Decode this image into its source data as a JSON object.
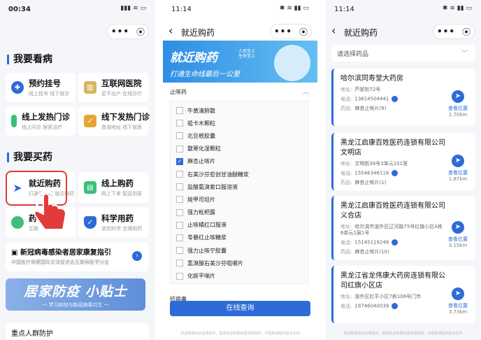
{
  "panel1": {
    "time": "00:34",
    "status_icons": "▮▮▮ ≋ ▭",
    "section_1": "我要看病",
    "cards_1": [
      {
        "title": "预约挂号",
        "sub": "线上挂号 线下就诊",
        "icon": "calendar-icon",
        "color": "#2f6bd8"
      },
      {
        "title": "互联网医院",
        "sub": "足不出户 在线诊疗",
        "icon": "hospital-icon",
        "color": "#d9b45f"
      },
      {
        "title": "线上发热门诊",
        "sub": "线上问诊 居家治疗",
        "icon": "thermometer-icon",
        "color": "#3bbf7a"
      },
      {
        "title": "线下发热门诊",
        "sub": "查询地址 线下就医",
        "icon": "clipboard-icon",
        "color": "#e8a531"
      }
    ],
    "section_2": "我要买药",
    "cards_2": [
      {
        "title": "就近购药",
        "sub": "打通生命线 就近购药",
        "icon": "location-arrow-icon",
        "color": "#2f6bd8"
      },
      {
        "title": "线上购药",
        "sub": "网上下单 配送到家",
        "icon": "pill-bottle-icon",
        "color": "#3bbf7a"
      },
      {
        "title": "药",
        "sub": "互联",
        "icon": "capsule-icon",
        "color": "#3bbf7a"
      },
      {
        "title": "科学用药",
        "sub": "讲究科学 合理用药",
        "icon": "shield-icon",
        "color": "#2f6bd8"
      }
    ],
    "notice_title": "新冠病毒感染者居家康复指引",
    "notice_sub": "中国医疗保健国际交流促进会互联网医学分会",
    "banner_title": "居家防疫 小贴士",
    "banner_sub": "一 学习如何与新冠病毒共生 一",
    "bottom_item": "重点人群防护"
  },
  "panel2": {
    "time": "11:14",
    "status_icons": "✱ ≋ ▮▮ ▭",
    "title": "就近购药",
    "back": "‹",
    "hero_title": "就近购药",
    "hero_sub": "打通生命线最后一公里",
    "hero_tag": "人民至上 生命至上",
    "category_1": "止咳药",
    "drugs": [
      {
        "name": "牛黄清肺散",
        "checked": false
      },
      {
        "name": "祖卡木颗粒",
        "checked": false
      },
      {
        "name": "北豆根胶囊",
        "checked": false
      },
      {
        "name": "散寒化湿颗粒",
        "checked": false
      },
      {
        "name": "麻杏止咳片",
        "checked": true
      },
      {
        "name": "右美沙芬愈创甘油醚糖浆",
        "checked": false
      },
      {
        "name": "盐酸氨溴索口服溶液",
        "checked": false
      },
      {
        "name": "羧甲司坦片",
        "checked": false
      },
      {
        "name": "强力枇杷露",
        "checked": false
      },
      {
        "name": "止咳橘红口服液",
        "checked": false
      },
      {
        "name": "苓暴红止咳糖浆",
        "checked": false
      },
      {
        "name": "强力止咳宁胶囊",
        "checked": false
      },
      {
        "name": "氢溴酸右美沙芬咀嚼片",
        "checked": false
      },
      {
        "name": "化痰平喘片",
        "checked": false
      }
    ],
    "category_2": "抗病毒",
    "query_button": "在线查询",
    "footer": "药店数据由药监局提供，医保药店数据由医保局提供，中国联通提供技术支持"
  },
  "panel3": {
    "time": "11:14",
    "status_icons": "✱ ≋ ▮▮ ▭",
    "title": "就近购药",
    "back": "‹",
    "select_placeholder": "请选择药品",
    "labels": {
      "addr": "地址:",
      "phone": "电话:",
      "drug": "药品:"
    },
    "nav_label": "查看位置",
    "stores": [
      {
        "name": "哈尔滨同寿堂大药房",
        "addr": "芦家街72号",
        "phone": "13614504441",
        "drug": "麻杏止咳片(9)",
        "dist": "1.70km"
      },
      {
        "name": "黑龙江启康百姓医药连锁有限公司文明店",
        "addr": "文明街36号3单元101室",
        "phone": "15546346116",
        "drug": "麻杏止咳片(1)",
        "dist": "1.87km"
      },
      {
        "name": "黑龙江启康百姓医药连锁有限公司义合店",
        "addr": "哈尔滨市道外区辽河路75号红旗小区A栋6单元1层1号",
        "phone": "15145119248",
        "drug": "麻杏止咳片(10)",
        "dist": "3.15km"
      },
      {
        "name": "黑龙江省龙伟康大药房连锁有限公司红旗小区店",
        "addr": "道外区红平小区7栋106号门市",
        "phone": "18746040039",
        "drug": "",
        "dist": "3.73km"
      }
    ],
    "footer": "药店数据由药监局提供，医保药店数据由医保局提供，中国联通提供技术支持"
  }
}
